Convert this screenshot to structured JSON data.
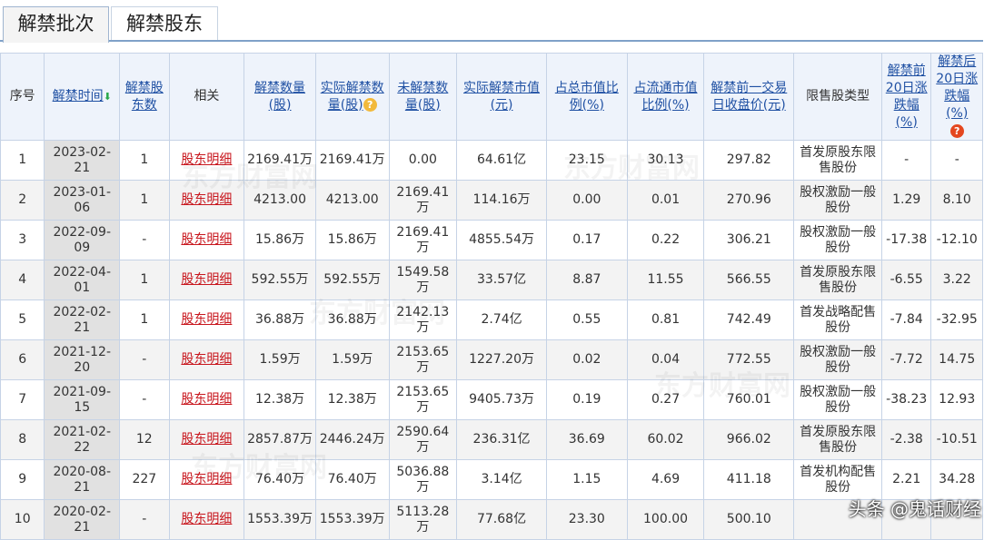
{
  "tabs": [
    {
      "label": "解禁批次"
    },
    {
      "label": "解禁股东"
    }
  ],
  "headers": {
    "seq": "序号",
    "date": "解禁时间",
    "holders": "解禁股东数",
    "related": "相关",
    "shares": "解禁数量(股)",
    "actual_shares": "实际解禁数量(股)",
    "unreleased": "未解禁数量(股)",
    "actual_value": "实际解禁市值(元)",
    "total_pct": "占总市值比例(%)",
    "float_pct": "占流通市值比例(%)",
    "prev_close": "解禁前一交易日收盘价(元)",
    "lock_type": "限售股类型",
    "before20": "解禁前20日涨跌幅(%)",
    "after20": "解禁后20日涨跌幅(%)"
  },
  "rows": [
    {
      "seq": "1",
      "date": "2023-02-21",
      "holders": "1",
      "related": "股东明细",
      "shares": "2169.41万",
      "actual": "2169.41万",
      "unreleased": "0.00",
      "value": "64.61亿",
      "total_pct": "23.15",
      "float_pct": "30.13",
      "prev_close": "297.82",
      "lock_type": "首发原股东限售股份",
      "before20": "-",
      "after20": "-"
    },
    {
      "seq": "2",
      "date": "2023-01-06",
      "holders": "1",
      "related": "股东明细",
      "shares": "4213.00",
      "actual": "4213.00",
      "unreleased": "2169.41万",
      "value": "114.16万",
      "total_pct": "0.00",
      "float_pct": "0.01",
      "prev_close": "270.96",
      "lock_type": "股权激励一般股份",
      "before20": "1.29",
      "after20": "8.10"
    },
    {
      "seq": "3",
      "date": "2022-09-09",
      "holders": "-",
      "related": "股东明细",
      "shares": "15.86万",
      "actual": "15.86万",
      "unreleased": "2169.41万",
      "value": "4855.54万",
      "total_pct": "0.17",
      "float_pct": "0.22",
      "prev_close": "306.21",
      "lock_type": "股权激励一般股份",
      "before20": "-17.38",
      "after20": "-12.10"
    },
    {
      "seq": "4",
      "date": "2022-04-01",
      "holders": "1",
      "related": "股东明细",
      "shares": "592.55万",
      "actual": "592.55万",
      "unreleased": "1549.58万",
      "value": "33.57亿",
      "total_pct": "8.87",
      "float_pct": "11.55",
      "prev_close": "566.55",
      "lock_type": "首发原股东限售股份",
      "before20": "-6.55",
      "after20": "3.22"
    },
    {
      "seq": "5",
      "date": "2022-02-21",
      "holders": "1",
      "related": "股东明细",
      "shares": "36.88万",
      "actual": "36.88万",
      "unreleased": "2142.13万",
      "value": "2.74亿",
      "total_pct": "0.55",
      "float_pct": "0.81",
      "prev_close": "742.49",
      "lock_type": "首发战略配售股份",
      "before20": "-7.84",
      "after20": "-32.95"
    },
    {
      "seq": "6",
      "date": "2021-12-20",
      "holders": "-",
      "related": "股东明细",
      "shares": "1.59万",
      "actual": "1.59万",
      "unreleased": "2153.65万",
      "value": "1227.20万",
      "total_pct": "0.02",
      "float_pct": "0.04",
      "prev_close": "772.55",
      "lock_type": "股权激励一般股份",
      "before20": "-7.72",
      "after20": "14.75"
    },
    {
      "seq": "7",
      "date": "2021-09-15",
      "holders": "-",
      "related": "股东明细",
      "shares": "12.38万",
      "actual": "12.38万",
      "unreleased": "2153.65万",
      "value": "9405.73万",
      "total_pct": "0.19",
      "float_pct": "0.27",
      "prev_close": "760.01",
      "lock_type": "股权激励一般股份",
      "before20": "-38.23",
      "after20": "12.93"
    },
    {
      "seq": "8",
      "date": "2021-02-22",
      "holders": "12",
      "related": "股东明细",
      "shares": "2857.87万",
      "actual": "2446.24万",
      "unreleased": "2590.64万",
      "value": "236.31亿",
      "total_pct": "36.69",
      "float_pct": "60.02",
      "prev_close": "966.02",
      "lock_type": "首发原股东限售股份",
      "before20": "-2.38",
      "after20": "-10.51"
    },
    {
      "seq": "9",
      "date": "2020-08-21",
      "holders": "227",
      "related": "股东明细",
      "shares": "76.40万",
      "actual": "76.40万",
      "unreleased": "5036.88万",
      "value": "3.14亿",
      "total_pct": "1.15",
      "float_pct": "4.69",
      "prev_close": "411.18",
      "lock_type": "首发机构配售股份",
      "before20": "2.21",
      "after20": "34.28"
    },
    {
      "seq": "10",
      "date": "2020-02-21",
      "holders": "-",
      "related": "股东明细",
      "shares": "1553.39万",
      "actual": "1553.39万",
      "unreleased": "5113.28万",
      "value": "77.68亿",
      "total_pct": "23.30",
      "float_pct": "100.00",
      "prev_close": "500.10",
      "lock_type": "",
      "before20": "",
      "after20": ""
    }
  ],
  "watermark": {
    "cn": "东方财富网",
    "en": "eastmoney.com"
  },
  "brand": "头条 @鬼话财经",
  "colors": {
    "up": "#e3212b",
    "down": "#12962e",
    "link": "#1f50a3",
    "detail": "#c8161d",
    "header_bg": "#eef3fb"
  }
}
